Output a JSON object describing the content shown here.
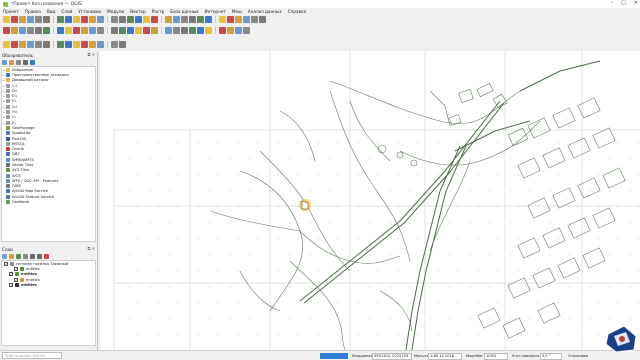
{
  "window": {
    "title": "*Проект без названия — QGIS",
    "controls": [
      "–",
      "□",
      "✕"
    ]
  },
  "menu": [
    "Проект",
    "Правка",
    "Вид",
    "Слой",
    "Установки",
    "Модули",
    "Вектор",
    "Растр",
    "База данных",
    "Интернет",
    "Меш",
    "Анализ данных",
    "Справка"
  ],
  "toolbar_icons": [
    "new-project",
    "open-project",
    "save-project",
    "save-as",
    "print-layout",
    "layout-manager",
    "pan",
    "pan-to-selection",
    "zoom-in",
    "zoom-out",
    "zoom-full",
    "zoom-selection",
    "zoom-layer",
    "zoom-native",
    "zoom-last",
    "zoom-next",
    "new-map-view",
    "temporal",
    "refresh",
    "identify",
    "select",
    "deselect",
    "field-calc",
    "attribute-table",
    "stats",
    "measure",
    "annotation",
    "map-tips",
    "label",
    "text"
  ],
  "browser": {
    "title": "Обозреватель",
    "items": [
      {
        "label": "Избранное",
        "icon": "star-icon",
        "color": "#e8c23a",
        "expand": true
      },
      {
        "label": "Пространственные закладки",
        "icon": "bookmark-icon",
        "color": "#3a78c8",
        "expand": true
      },
      {
        "label": "Домашний каталог",
        "icon": "folder-icon",
        "color": "#e0b54a",
        "expand": true
      },
      {
        "label": "C:\\",
        "icon": "drive-icon",
        "color": "#9a9a9a",
        "expand": true
      },
      {
        "label": "D:\\",
        "icon": "drive-icon",
        "color": "#9a9a9a",
        "expand": true
      },
      {
        "label": "E:\\",
        "icon": "drive-icon",
        "color": "#9a9a9a",
        "expand": true
      },
      {
        "label": "F:\\",
        "icon": "drive-icon",
        "color": "#9a9a9a",
        "expand": true
      },
      {
        "label": "G:\\",
        "icon": "drive-icon",
        "color": "#9a9a9a",
        "expand": true
      },
      {
        "label": "H:\\",
        "icon": "drive-icon",
        "color": "#9a9a9a",
        "expand": true
      },
      {
        "label": "I:\\",
        "icon": "drive-icon",
        "color": "#9a9a9a",
        "expand": true
      },
      {
        "label": "J:\\",
        "icon": "drive-icon",
        "color": "#9a9a9a",
        "expand": true
      },
      {
        "label": "GeoPackage",
        "icon": "geopackage-icon",
        "color": "#7a9a3a",
        "expand": false
      },
      {
        "label": "SpatiaLite",
        "icon": "spatialite-icon",
        "color": "#4a7aba",
        "expand": false
      },
      {
        "label": "PostGIS",
        "icon": "postgis-icon",
        "color": "#3a5a9a",
        "expand": false
      },
      {
        "label": "MSSQL",
        "icon": "mssql-icon",
        "color": "#9a9a9a",
        "expand": false
      },
      {
        "label": "Oracle",
        "icon": "oracle-icon",
        "color": "#c83a3a",
        "expand": false
      },
      {
        "label": "DB2",
        "icon": "db2-icon",
        "color": "#3a6ab8",
        "expand": false
      },
      {
        "label": "WMS/WMTS",
        "icon": "wms-icon",
        "color": "#5a8ac8",
        "expand": false
      },
      {
        "label": "Vector Tiles",
        "icon": "vector-tiles-icon",
        "color": "#6a6a6a",
        "expand": false
      },
      {
        "label": "XYZ Tiles",
        "icon": "xyz-icon",
        "color": "#6a8a3a",
        "expand": false
      },
      {
        "label": "WCS",
        "icon": "wcs-icon",
        "color": "#5a8ac8",
        "expand": false
      },
      {
        "label": "WFS / OGC API - Features",
        "icon": "wfs-icon",
        "color": "#5a8ac8",
        "expand": false
      },
      {
        "label": "OWS",
        "icon": "ows-icon",
        "color": "#7a7a7a",
        "expand": false
      },
      {
        "label": "ArcGIS Map Service",
        "icon": "arcgis-icon",
        "color": "#3a7ab8",
        "expand": false
      },
      {
        "label": "ArcGIS Feature Service",
        "icon": "arcgis-icon",
        "color": "#3a7ab8",
        "expand": false
      },
      {
        "label": "GeoNode",
        "icon": "geonode-icon",
        "color": "#4a9a5a",
        "expand": false
      }
    ]
  },
  "layers": {
    "title": "Слои",
    "items": [
      {
        "label": "генплан поселка Таежный",
        "indent": 0,
        "color": "#8a8a8a"
      },
      {
        "label": "entities",
        "indent": 2,
        "color": "#5a8a3a"
      },
      {
        "label": "entities",
        "indent": 1,
        "color": "#5a8a3a",
        "bold": true
      },
      {
        "label": "entities",
        "indent": 2,
        "color": "#c89a3a"
      },
      {
        "label": "entities",
        "indent": 1,
        "color": "#2a2a2a",
        "bold": true
      }
    ]
  },
  "status": {
    "search_placeholder": "Type to locate (Ctrl+K)",
    "coordinate_label": "Координата",
    "coordinate_value": "4991303, 0725703",
    "scale_label": "Масштаб",
    "scale_value": "1:66 14 2018",
    "magnifier_label": "Magnifier",
    "magnifier_value": "100%",
    "rotation_label": "Угол поворота",
    "rotation_value": "0,0 °",
    "render_label": "Отрисовка",
    "crs": "EPSG:..."
  },
  "colors": {
    "map_line": "#5f7f5a",
    "progress": "#2f7fd6"
  }
}
